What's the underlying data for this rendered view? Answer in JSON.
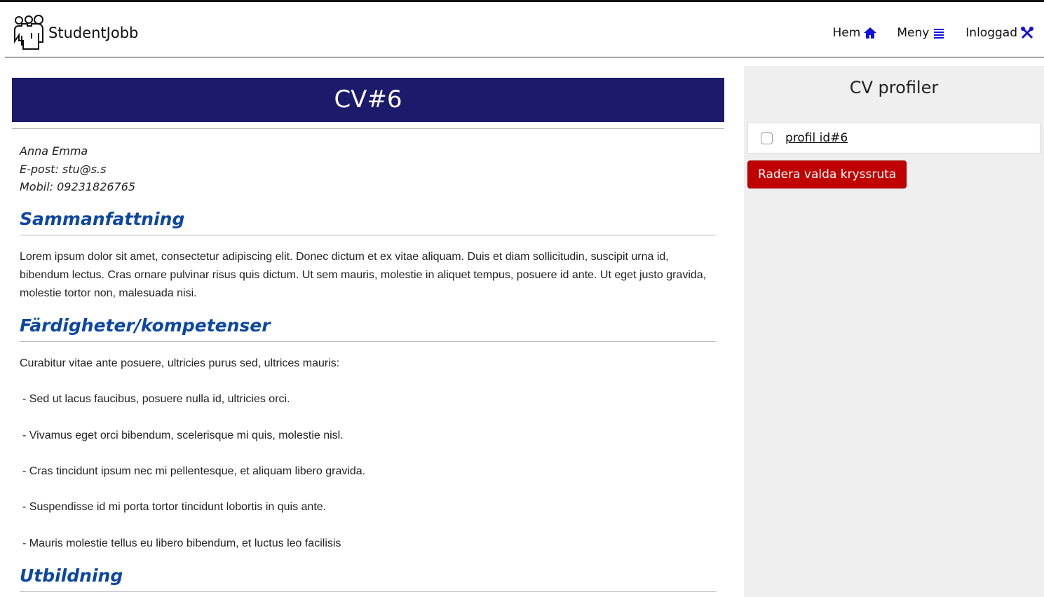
{
  "header": {
    "brand": "StudentJobb",
    "nav": [
      {
        "label": "Hem",
        "icon": "home-icon"
      },
      {
        "label": "Meny",
        "icon": "list-icon"
      },
      {
        "label": "Inloggad",
        "icon": "tools-icon"
      }
    ]
  },
  "cv": {
    "title": "CV#6",
    "name": "Anna Emma",
    "email": "E-post: stu@s.s",
    "mobile": "Mobil: 09231826765",
    "summary_heading": "Sammanfattning",
    "summary_text": "Lorem ipsum dolor sit amet, consectetur adipiscing elit. Donec dictum et ex vitae aliquam. Duis et diam sollicitudin, suscipit urna id, bibendum lectus. Cras ornare pulvinar risus quis dictum. Ut sem mauris, molestie in aliquet tempus, posuere id ante. Ut eget justo gravida, molestie tortor non, malesuada nisi.",
    "skills_heading": "Färdigheter/kompetenser",
    "skills_intro": "Curabitur vitae ante posuere, ultricies purus sed, ultrices mauris:",
    "skills": [
      "- Sed ut lacus faucibus, posuere nulla id, ultricies orci.",
      "- Vivamus eget orci bibendum, scelerisque mi quis, molestie nisl.",
      "- Cras tincidunt ipsum nec mi pellentesque, et aliquam libero gravida.",
      "- Suspendisse id mi porta tortor tincidunt lobortis in quis ante.",
      "- Mauris molestie tellus eu libero bibendum, et luctus leo facilisis"
    ],
    "education_heading": "Utbildning"
  },
  "sidebar": {
    "title": "CV profiler",
    "profiles": [
      {
        "label": "profil id#6",
        "checked": false
      }
    ],
    "delete_button": "Radera valda kryssruta"
  },
  "colors": {
    "banner": "#1c1a6b",
    "heading": "#0d47a1",
    "nav_icon": "#1010e0",
    "delete": "#c00000",
    "sidebar_bg": "#efefef"
  }
}
